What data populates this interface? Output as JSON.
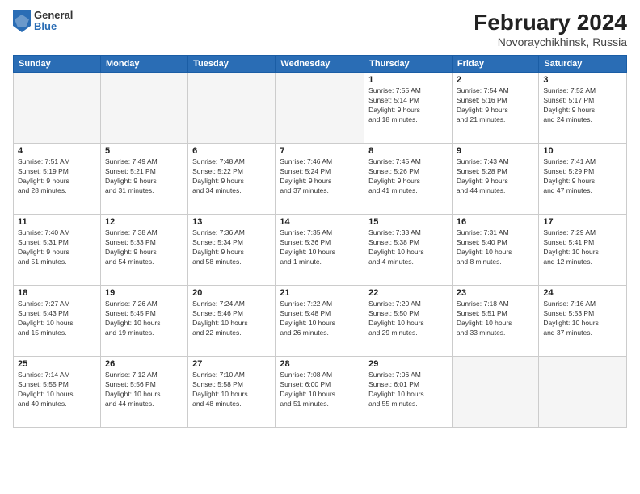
{
  "header": {
    "logo": {
      "general": "General",
      "blue": "Blue"
    },
    "title": "February 2024",
    "subtitle": "Novoraychikhinsk, Russia"
  },
  "days_of_week": [
    "Sunday",
    "Monday",
    "Tuesday",
    "Wednesday",
    "Thursday",
    "Friday",
    "Saturday"
  ],
  "weeks": [
    [
      {
        "day": "",
        "info": ""
      },
      {
        "day": "",
        "info": ""
      },
      {
        "day": "",
        "info": ""
      },
      {
        "day": "",
        "info": ""
      },
      {
        "day": "1",
        "info": "Sunrise: 7:55 AM\nSunset: 5:14 PM\nDaylight: 9 hours\nand 18 minutes."
      },
      {
        "day": "2",
        "info": "Sunrise: 7:54 AM\nSunset: 5:16 PM\nDaylight: 9 hours\nand 21 minutes."
      },
      {
        "day": "3",
        "info": "Sunrise: 7:52 AM\nSunset: 5:17 PM\nDaylight: 9 hours\nand 24 minutes."
      }
    ],
    [
      {
        "day": "4",
        "info": "Sunrise: 7:51 AM\nSunset: 5:19 PM\nDaylight: 9 hours\nand 28 minutes."
      },
      {
        "day": "5",
        "info": "Sunrise: 7:49 AM\nSunset: 5:21 PM\nDaylight: 9 hours\nand 31 minutes."
      },
      {
        "day": "6",
        "info": "Sunrise: 7:48 AM\nSunset: 5:22 PM\nDaylight: 9 hours\nand 34 minutes."
      },
      {
        "day": "7",
        "info": "Sunrise: 7:46 AM\nSunset: 5:24 PM\nDaylight: 9 hours\nand 37 minutes."
      },
      {
        "day": "8",
        "info": "Sunrise: 7:45 AM\nSunset: 5:26 PM\nDaylight: 9 hours\nand 41 minutes."
      },
      {
        "day": "9",
        "info": "Sunrise: 7:43 AM\nSunset: 5:28 PM\nDaylight: 9 hours\nand 44 minutes."
      },
      {
        "day": "10",
        "info": "Sunrise: 7:41 AM\nSunset: 5:29 PM\nDaylight: 9 hours\nand 47 minutes."
      }
    ],
    [
      {
        "day": "11",
        "info": "Sunrise: 7:40 AM\nSunset: 5:31 PM\nDaylight: 9 hours\nand 51 minutes."
      },
      {
        "day": "12",
        "info": "Sunrise: 7:38 AM\nSunset: 5:33 PM\nDaylight: 9 hours\nand 54 minutes."
      },
      {
        "day": "13",
        "info": "Sunrise: 7:36 AM\nSunset: 5:34 PM\nDaylight: 9 hours\nand 58 minutes."
      },
      {
        "day": "14",
        "info": "Sunrise: 7:35 AM\nSunset: 5:36 PM\nDaylight: 10 hours\nand 1 minute."
      },
      {
        "day": "15",
        "info": "Sunrise: 7:33 AM\nSunset: 5:38 PM\nDaylight: 10 hours\nand 4 minutes."
      },
      {
        "day": "16",
        "info": "Sunrise: 7:31 AM\nSunset: 5:40 PM\nDaylight: 10 hours\nand 8 minutes."
      },
      {
        "day": "17",
        "info": "Sunrise: 7:29 AM\nSunset: 5:41 PM\nDaylight: 10 hours\nand 12 minutes."
      }
    ],
    [
      {
        "day": "18",
        "info": "Sunrise: 7:27 AM\nSunset: 5:43 PM\nDaylight: 10 hours\nand 15 minutes."
      },
      {
        "day": "19",
        "info": "Sunrise: 7:26 AM\nSunset: 5:45 PM\nDaylight: 10 hours\nand 19 minutes."
      },
      {
        "day": "20",
        "info": "Sunrise: 7:24 AM\nSunset: 5:46 PM\nDaylight: 10 hours\nand 22 minutes."
      },
      {
        "day": "21",
        "info": "Sunrise: 7:22 AM\nSunset: 5:48 PM\nDaylight: 10 hours\nand 26 minutes."
      },
      {
        "day": "22",
        "info": "Sunrise: 7:20 AM\nSunset: 5:50 PM\nDaylight: 10 hours\nand 29 minutes."
      },
      {
        "day": "23",
        "info": "Sunrise: 7:18 AM\nSunset: 5:51 PM\nDaylight: 10 hours\nand 33 minutes."
      },
      {
        "day": "24",
        "info": "Sunrise: 7:16 AM\nSunset: 5:53 PM\nDaylight: 10 hours\nand 37 minutes."
      }
    ],
    [
      {
        "day": "25",
        "info": "Sunrise: 7:14 AM\nSunset: 5:55 PM\nDaylight: 10 hours\nand 40 minutes."
      },
      {
        "day": "26",
        "info": "Sunrise: 7:12 AM\nSunset: 5:56 PM\nDaylight: 10 hours\nand 44 minutes."
      },
      {
        "day": "27",
        "info": "Sunrise: 7:10 AM\nSunset: 5:58 PM\nDaylight: 10 hours\nand 48 minutes."
      },
      {
        "day": "28",
        "info": "Sunrise: 7:08 AM\nSunset: 6:00 PM\nDaylight: 10 hours\nand 51 minutes."
      },
      {
        "day": "29",
        "info": "Sunrise: 7:06 AM\nSunset: 6:01 PM\nDaylight: 10 hours\nand 55 minutes."
      },
      {
        "day": "",
        "info": ""
      },
      {
        "day": "",
        "info": ""
      }
    ]
  ]
}
